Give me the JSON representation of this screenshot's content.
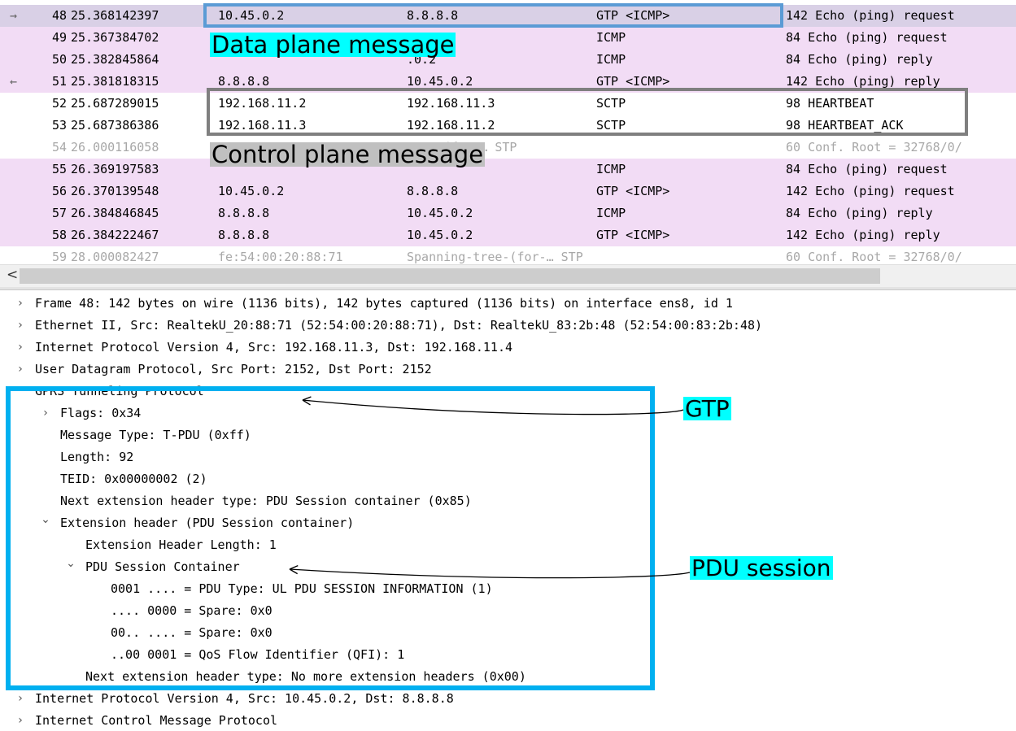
{
  "packets": [
    {
      "no": "48",
      "time": "25.368142397",
      "src": "10.45.0.2",
      "dst": "8.8.8.8",
      "proto": "GTP <ICMP>",
      "info": "142 Echo (ping) request",
      "style": "sel",
      "marker": "→"
    },
    {
      "no": "49",
      "time": "25.367384702",
      "src": "",
      "dst": ".8",
      "proto": "ICMP",
      "info": "84 Echo (ping) request",
      "style": "pink",
      "marker": ""
    },
    {
      "no": "50",
      "time": "25.382845864",
      "src": "",
      "dst": ".0.2",
      "proto": "ICMP",
      "info": "84 Echo (ping) reply",
      "style": "pink",
      "marker": ""
    },
    {
      "no": "51",
      "time": "25.381818315",
      "src": "8.8.8.8",
      "dst": "10.45.0.2",
      "proto": "GTP <ICMP>",
      "info": "142 Echo (ping) reply",
      "style": "pink",
      "marker": "←"
    },
    {
      "no": "52",
      "time": "25.687289015",
      "src": "192.168.11.2",
      "dst": "192.168.11.3",
      "proto": "SCTP",
      "info": "98 HEARTBEAT",
      "style": "white",
      "marker": ""
    },
    {
      "no": "53",
      "time": "25.687386386",
      "src": "192.168.11.3",
      "dst": "192.168.11.2",
      "proto": "SCTP",
      "info": "98 HEARTBEAT_ACK",
      "style": "white",
      "marker": ""
    },
    {
      "no": "54",
      "time": "26.000116058",
      "src": "",
      "dst": "tree-(for-… STP",
      "proto": "",
      "info": "60 Conf. Root = 32768/0/",
      "style": "white dim",
      "marker": ""
    },
    {
      "no": "55",
      "time": "26.369197583",
      "src": "",
      "dst": "",
      "proto": "ICMP",
      "info": "84 Echo (ping) request",
      "style": "pink",
      "marker": ""
    },
    {
      "no": "56",
      "time": "26.370139548",
      "src": "10.45.0.2",
      "dst": "8.8.8.8",
      "proto": "GTP <ICMP>",
      "info": "142 Echo (ping) request",
      "style": "pink",
      "marker": ""
    },
    {
      "no": "57",
      "time": "26.384846845",
      "src": "8.8.8.8",
      "dst": "10.45.0.2",
      "proto": "ICMP",
      "info": "84 Echo (ping) reply",
      "style": "pink",
      "marker": ""
    },
    {
      "no": "58",
      "time": "26.384222467",
      "src": "8.8.8.8",
      "dst": "10.45.0.2",
      "proto": "GTP <ICMP>",
      "info": "142 Echo (ping) reply",
      "style": "pink",
      "marker": ""
    },
    {
      "no": "59",
      "time": "28.000082427",
      "src": "fe:54:00:20:88:71",
      "dst": "Spanning-tree-(for-… STP",
      "proto": "",
      "info": "60 Conf. Root = 32768/0/",
      "style": "white dim",
      "marker": ""
    }
  ],
  "scroll_left_glyph": "<",
  "details": [
    {
      "toggle": "›",
      "indent": 0,
      "text": "Frame 48: 142 bytes on wire (1136 bits), 142 bytes captured (1136 bits) on interface ens8, id 1"
    },
    {
      "toggle": "›",
      "indent": 0,
      "text": "Ethernet II, Src: RealtekU_20:88:71 (52:54:00:20:88:71), Dst: RealtekU_83:2b:48 (52:54:00:83:2b:48)"
    },
    {
      "toggle": "›",
      "indent": 0,
      "text": "Internet Protocol Version 4, Src: 192.168.11.3, Dst: 192.168.11.4"
    },
    {
      "toggle": "›",
      "indent": 0,
      "text": "User Datagram Protocol, Src Port: 2152, Dst Port: 2152"
    },
    {
      "toggle": "⌄",
      "indent": 0,
      "text": "GPRS Tunneling Protocol"
    },
    {
      "toggle": "›",
      "indent": 1,
      "text": "Flags: 0x34"
    },
    {
      "toggle": "",
      "indent": 1,
      "text": "Message Type: T-PDU (0xff)"
    },
    {
      "toggle": "",
      "indent": 1,
      "text": "Length: 92"
    },
    {
      "toggle": "",
      "indent": 1,
      "text": "TEID: 0x00000002 (2)"
    },
    {
      "toggle": "",
      "indent": 1,
      "text": "Next extension header type: PDU Session container (0x85)"
    },
    {
      "toggle": "⌄",
      "indent": 1,
      "text": "Extension header (PDU Session container)"
    },
    {
      "toggle": "",
      "indent": 2,
      "text": "Extension Header Length: 1"
    },
    {
      "toggle": "⌄",
      "indent": 2,
      "text": "PDU Session Container"
    },
    {
      "toggle": "",
      "indent": 3,
      "text": "0001 .... = PDU Type: UL PDU SESSION INFORMATION (1)"
    },
    {
      "toggle": "",
      "indent": 3,
      "text": ".... 0000 = Spare: 0x0"
    },
    {
      "toggle": "",
      "indent": 3,
      "text": "00.. .... = Spare: 0x0"
    },
    {
      "toggle": "",
      "indent": 3,
      "text": "..00 0001 = QoS Flow Identifier (QFI): 1"
    },
    {
      "toggle": "",
      "indent": 2,
      "text": "Next extension header type: No more extension headers (0x00)"
    },
    {
      "toggle": "›",
      "indent": 0,
      "text": "Internet Protocol Version 4, Src: 10.45.0.2, Dst: 8.8.8.8"
    },
    {
      "toggle": "›",
      "indent": 0,
      "text": "Internet Control Message Protocol"
    }
  ],
  "annotations": {
    "data_plane": "Data plane message",
    "control_plane": "Control plane message",
    "gtp": "GTP",
    "pdu_session": "PDU session"
  },
  "colors": {
    "data_plane_bg": "#00ffff",
    "control_plane_bg": "#c0c0c0",
    "gtp_bg": "#00ffff",
    "pdu_bg": "#00ffff",
    "box_selected": "#5b9bd5",
    "box_control": "#7f7f7f",
    "box_gtp": "#00b0f0",
    "row_pink": "#f2dcf5",
    "row_selected": "#d9d0e6"
  },
  "icons": {
    "expanded": "chevron-down-icon",
    "collapsed": "chevron-right-icon",
    "related_request": "arrow-right-icon",
    "related_reply": "arrow-left-icon"
  }
}
